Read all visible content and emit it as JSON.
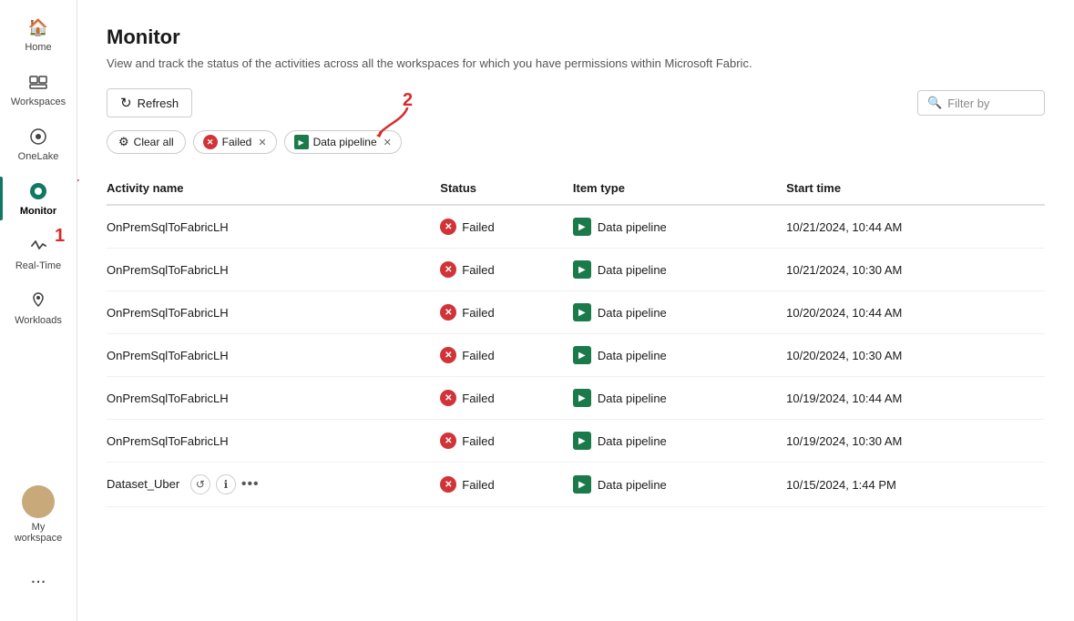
{
  "sidebar": {
    "items": [
      {
        "id": "home",
        "label": "Home",
        "icon": "🏠",
        "active": false
      },
      {
        "id": "workspaces",
        "label": "Workspaces",
        "icon": "🖥",
        "active": false
      },
      {
        "id": "onelake",
        "label": "OneLake",
        "icon": "◎",
        "active": false
      },
      {
        "id": "monitor",
        "label": "Monitor",
        "icon": "●",
        "active": true
      },
      {
        "id": "realtime",
        "label": "Real-Time",
        "icon": "⚡",
        "active": false
      },
      {
        "id": "workloads",
        "label": "Workloads",
        "icon": "⋮",
        "active": false
      }
    ],
    "myworkspace_label": "My workspace",
    "more_label": "..."
  },
  "header": {
    "title": "Monitor",
    "subtitle": "View and track the status of the activities across all the workspaces for which you have permissions within Microsoft Fabric."
  },
  "toolbar": {
    "refresh_label": "Refresh",
    "filter_placeholder": "Filter by"
  },
  "filters": {
    "clear_all_label": "Clear all",
    "chips": [
      {
        "id": "failed",
        "label": "Failed",
        "icon": "✕",
        "icon_type": "red_x"
      },
      {
        "id": "datapipeline",
        "label": "Data pipeline",
        "icon": "▶",
        "icon_type": "pipeline"
      }
    ]
  },
  "table": {
    "columns": [
      {
        "id": "activity_name",
        "label": "Activity name"
      },
      {
        "id": "status",
        "label": "Status"
      },
      {
        "id": "item_type",
        "label": "Item type"
      },
      {
        "id": "start_time",
        "label": "Start time"
      }
    ],
    "rows": [
      {
        "activity_name": "OnPremSqlToFabricLH",
        "status": "Failed",
        "item_type": "Data pipeline",
        "start_time": "10/21/2024, 10:44 AM",
        "has_actions": false
      },
      {
        "activity_name": "OnPremSqlToFabricLH",
        "status": "Failed",
        "item_type": "Data pipeline",
        "start_time": "10/21/2024, 10:30 AM",
        "has_actions": false
      },
      {
        "activity_name": "OnPremSqlToFabricLH",
        "status": "Failed",
        "item_type": "Data pipeline",
        "start_time": "10/20/2024, 10:44 AM",
        "has_actions": false
      },
      {
        "activity_name": "OnPremSqlToFabricLH",
        "status": "Failed",
        "item_type": "Data pipeline",
        "start_time": "10/20/2024, 10:30 AM",
        "has_actions": false
      },
      {
        "activity_name": "OnPremSqlToFabricLH",
        "status": "Failed",
        "item_type": "Data pipeline",
        "start_time": "10/19/2024, 10:44 AM",
        "has_actions": false
      },
      {
        "activity_name": "OnPremSqlToFabricLH",
        "status": "Failed",
        "item_type": "Data pipeline",
        "start_time": "10/19/2024, 10:30 AM",
        "has_actions": false
      },
      {
        "activity_name": "Dataset_Uber",
        "status": "Failed",
        "item_type": "Data pipeline",
        "start_time": "10/15/2024, 1:44 PM",
        "has_actions": true
      }
    ]
  },
  "annotations": {
    "arrow1_label": "1",
    "arrow2_label": "2"
  }
}
